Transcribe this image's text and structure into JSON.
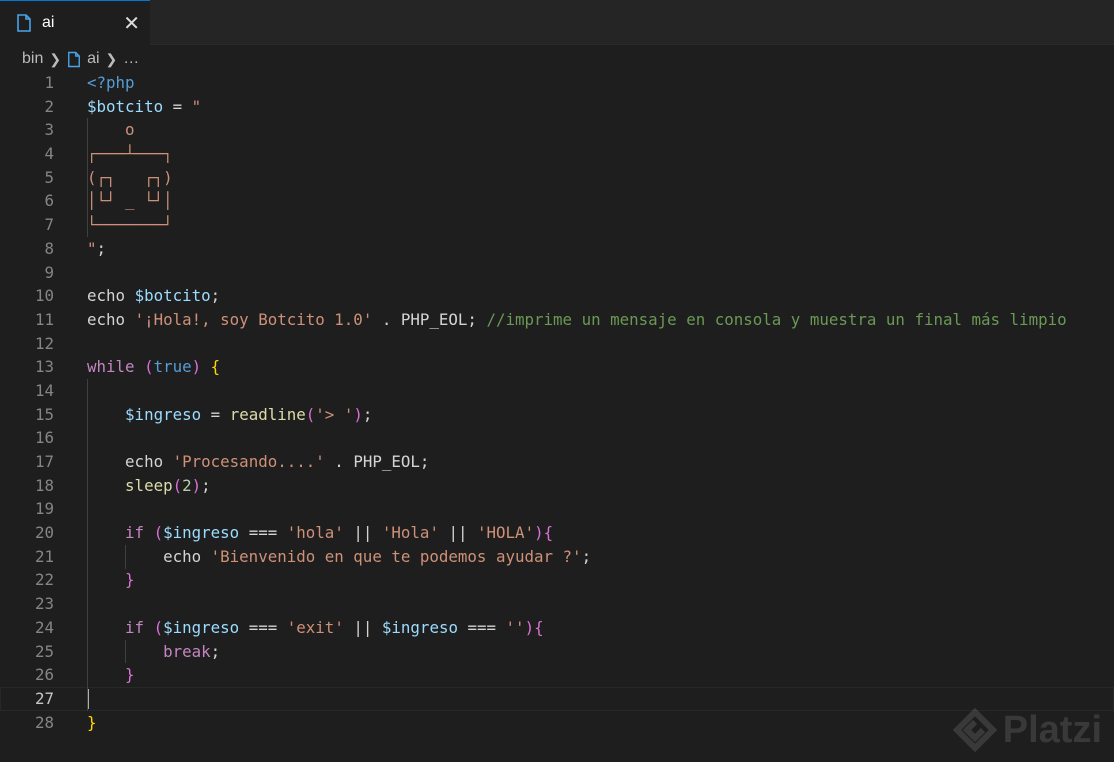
{
  "tab": {
    "label": "ai",
    "close": "✕",
    "icon": "file-icon"
  },
  "breadcrumb": {
    "items": [
      "bin",
      "ai",
      "…"
    ]
  },
  "watermark": "Platzi",
  "colors": {
    "bg": "#1e1e1e",
    "accent": "#0078d4"
  },
  "cursor_line": 27,
  "lines": [
    [
      [
        "<?php",
        "tag"
      ]
    ],
    [
      [
        "$botcito",
        "var"
      ],
      [
        " = ",
        "plain"
      ],
      [
        "\"",
        "str"
      ]
    ],
    [
      [
        "    o",
        "str"
      ]
    ],
    [
      [
        "┌───┴───┐",
        "str"
      ]
    ],
    [
      [
        "(┌┐   ┌┐)",
        "str"
      ]
    ],
    [
      [
        "│└┘ _ └┘│",
        "str"
      ]
    ],
    [
      [
        "└───────┘",
        "str"
      ]
    ],
    [
      [
        "\"",
        "str"
      ],
      [
        ";",
        "plain"
      ]
    ],
    [],
    [
      [
        "echo ",
        "plain"
      ],
      [
        "$botcito",
        "var"
      ],
      [
        ";",
        "plain"
      ]
    ],
    [
      [
        "echo ",
        "plain"
      ],
      [
        "'¡Hola!, soy Botcito 1.0'",
        "str"
      ],
      [
        " . PHP_EOL; ",
        "plain"
      ],
      [
        "//imprime un mensaje en consola y muestra un final más limpio",
        "com"
      ]
    ],
    [],
    [
      [
        "while",
        "kw"
      ],
      [
        " ",
        "plain"
      ],
      [
        "(",
        "b2"
      ],
      [
        "true",
        "bool"
      ],
      [
        ")",
        "b2"
      ],
      [
        " ",
        "plain"
      ],
      [
        "{",
        "b1"
      ]
    ],
    [],
    [
      [
        "    ",
        "plain"
      ],
      [
        "$ingreso",
        "var"
      ],
      [
        " = ",
        "plain"
      ],
      [
        "readline",
        "fn"
      ],
      [
        "(",
        "b2"
      ],
      [
        "'> '",
        "str"
      ],
      [
        ")",
        "b2"
      ],
      [
        ";",
        "plain"
      ]
    ],
    [],
    [
      [
        "    echo ",
        "plain"
      ],
      [
        "'Procesando....'",
        "str"
      ],
      [
        " . PHP_EOL;",
        "plain"
      ]
    ],
    [
      [
        "    ",
        "plain"
      ],
      [
        "sleep",
        "fn"
      ],
      [
        "(",
        "b2"
      ],
      [
        "2",
        "num"
      ],
      [
        ")",
        "b2"
      ],
      [
        ";",
        "plain"
      ]
    ],
    [],
    [
      [
        "    ",
        "plain"
      ],
      [
        "if",
        "kw"
      ],
      [
        " ",
        "plain"
      ],
      [
        "(",
        "b2"
      ],
      [
        "$ingreso",
        "var"
      ],
      [
        " === ",
        "plain"
      ],
      [
        "'hola'",
        "str"
      ],
      [
        " || ",
        "plain"
      ],
      [
        "'Hola'",
        "str"
      ],
      [
        " || ",
        "plain"
      ],
      [
        "'HOLA'",
        "str"
      ],
      [
        ")",
        "b2"
      ],
      [
        "{",
        "b2"
      ]
    ],
    [
      [
        "        echo ",
        "plain"
      ],
      [
        "'Bienvenido en que te podemos ayudar ?'",
        "str"
      ],
      [
        ";",
        "plain"
      ]
    ],
    [
      [
        "    ",
        "plain"
      ],
      [
        "}",
        "b2"
      ]
    ],
    [],
    [
      [
        "    ",
        "plain"
      ],
      [
        "if",
        "kw"
      ],
      [
        " ",
        "plain"
      ],
      [
        "(",
        "b2"
      ],
      [
        "$ingreso",
        "var"
      ],
      [
        " === ",
        "plain"
      ],
      [
        "'exit'",
        "str"
      ],
      [
        " || ",
        "plain"
      ],
      [
        "$ingreso",
        "var"
      ],
      [
        " === ",
        "plain"
      ],
      [
        "''",
        "str"
      ],
      [
        ")",
        "b2"
      ],
      [
        "{",
        "b2"
      ]
    ],
    [
      [
        "        ",
        "plain"
      ],
      [
        "break",
        "kw"
      ],
      [
        ";",
        "plain"
      ]
    ],
    [
      [
        "    ",
        "plain"
      ],
      [
        "}",
        "b2"
      ]
    ],
    [],
    [
      [
        "}",
        "b1"
      ]
    ]
  ]
}
